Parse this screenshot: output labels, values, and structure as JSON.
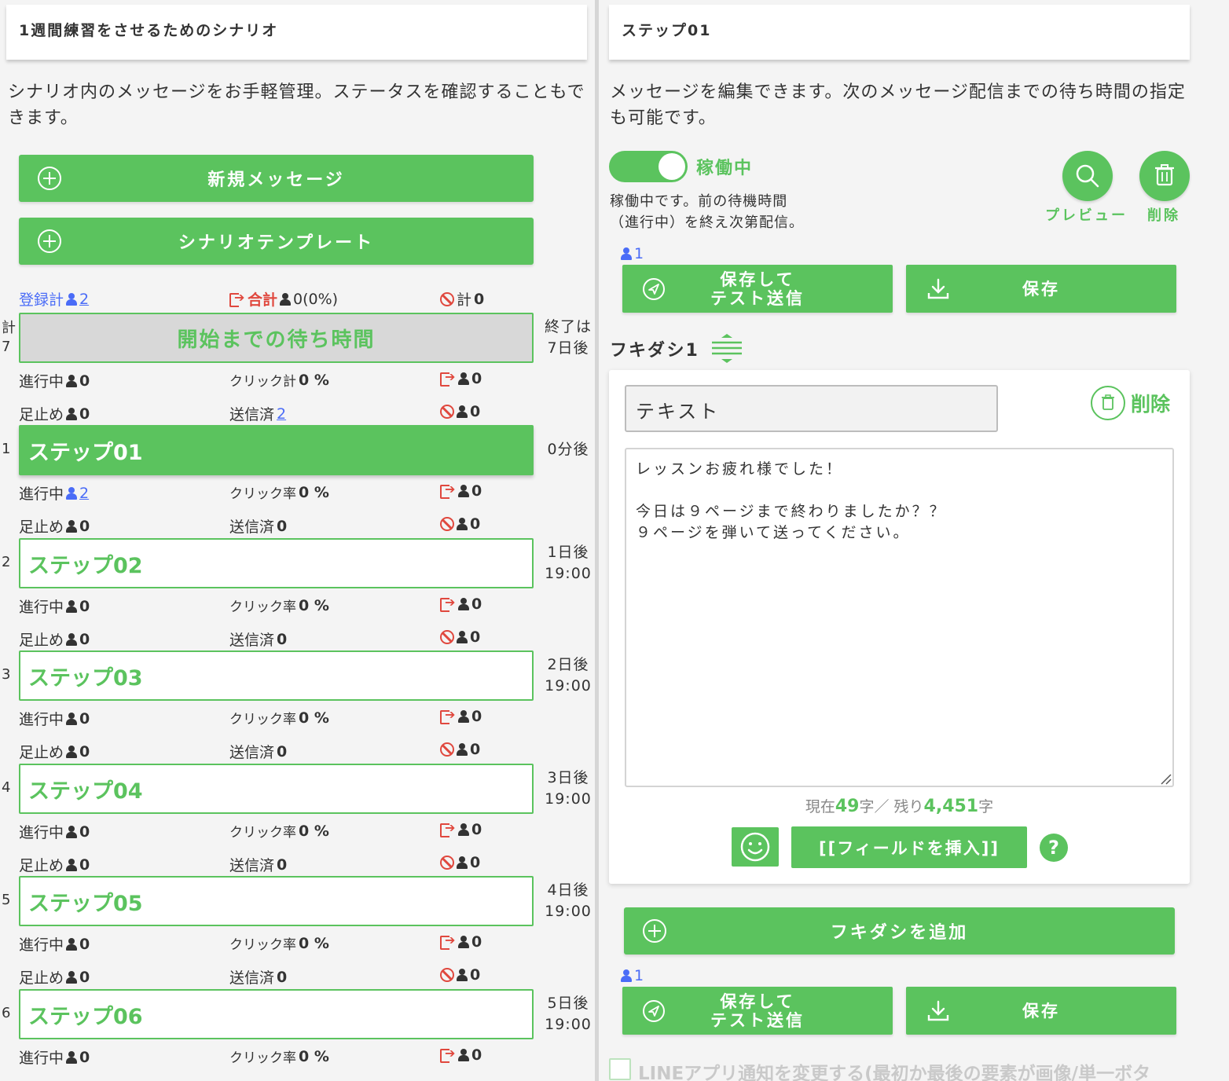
{
  "left": {
    "scenario_title": "1週間練習をさせるためのシナリオ",
    "description": "シナリオ内のメッセージをお手軽管理。ステータスを確認することもできます。",
    "new_message_label": "新規メッセージ",
    "template_label": "シナリオテンプレート",
    "summary": {
      "registered_label": "登録計",
      "registered_count": "2",
      "total_label": "合計",
      "total_value": "0(0%)",
      "blocked_label": "計",
      "blocked_count": "0"
    },
    "wait": {
      "index_label": "計",
      "index_value": "7",
      "label": "開始までの待ち時間",
      "after_line1": "終了は",
      "after_line2": "7日後",
      "row1": {
        "progress_label": "進行中",
        "progress": "0",
        "click_label": "クリック計",
        "click": "0 %",
        "exit": "0"
      },
      "row2": {
        "stop_label": "足止め",
        "stop": "0",
        "sent_label": "送信済",
        "sent": "2",
        "block": "0"
      }
    },
    "steps": [
      {
        "index": "1",
        "name": "ステップ01",
        "after1": "0分後",
        "after2": "",
        "progress": "2",
        "click": "0 %",
        "exit": "0",
        "stop": "0",
        "sent": "0",
        "block": "0"
      },
      {
        "index": "2",
        "name": "ステップ02",
        "after1": "1日後",
        "after2": "19:00",
        "progress": "0",
        "click": "0 %",
        "exit": "0",
        "stop": "0",
        "sent": "0",
        "block": "0"
      },
      {
        "index": "3",
        "name": "ステップ03",
        "after1": "2日後",
        "after2": "19:00",
        "progress": "0",
        "click": "0 %",
        "exit": "0",
        "stop": "0",
        "sent": "0",
        "block": "0"
      },
      {
        "index": "4",
        "name": "ステップ04",
        "after1": "3日後",
        "after2": "19:00",
        "progress": "0",
        "click": "0 %",
        "exit": "0",
        "stop": "0",
        "sent": "0",
        "block": "0"
      },
      {
        "index": "5",
        "name": "ステップ05",
        "after1": "4日後",
        "after2": "19:00",
        "progress": "0",
        "click": "0 %",
        "exit": "0",
        "stop": "0",
        "sent": "0",
        "block": "0"
      },
      {
        "index": "6",
        "name": "ステップ06",
        "after1": "5日後",
        "after2": "19:00",
        "progress": "0",
        "click": "0 %",
        "exit": "0"
      }
    ],
    "progress_label": "進行中",
    "click_rate_label": "クリック率",
    "stop_label": "足止め",
    "sent_label": "送信済"
  },
  "right": {
    "step_title": "ステップ01",
    "description": "メッセージを編集できます。次のメッセージ配信までの待ち時間の指定も可能です。",
    "toggle_label": "稼働中",
    "status_text_line1": "稼働中です。前の待機時間",
    "status_text_line2": "（進行中）を終え次第配信。",
    "preview_label": "プレビュー",
    "delete_label": "削除",
    "user_count": "1",
    "save_test_line1": "保存して",
    "save_test_line2": "テスト送信",
    "save_label": "保存",
    "bubble_title": "フキダシ1",
    "bubble_type": "テキスト",
    "bubble_delete": "削除",
    "message_text": "レッスンお疲れ様でした！\n\n今日は９ページまで終わりましたか？？\n９ページを弾いて送ってください。",
    "count_prefix": "現在",
    "count_current": "49",
    "count_mid": "字／ 残り",
    "count_remaining": "4,451",
    "count_suffix": "字",
    "insert_field_label": "[[フィールドを挿入]]",
    "help_label": "?",
    "add_bubble_label": "フキダシを追加",
    "user_count_bottom": "1",
    "line_notify_label": "LINEアプリ通知を変更する(最初か最後の要素が画像/単一ボタ"
  },
  "colors": {
    "accent": "#5bc35e",
    "link": "#4a6cf7",
    "danger": "#e0483e"
  }
}
